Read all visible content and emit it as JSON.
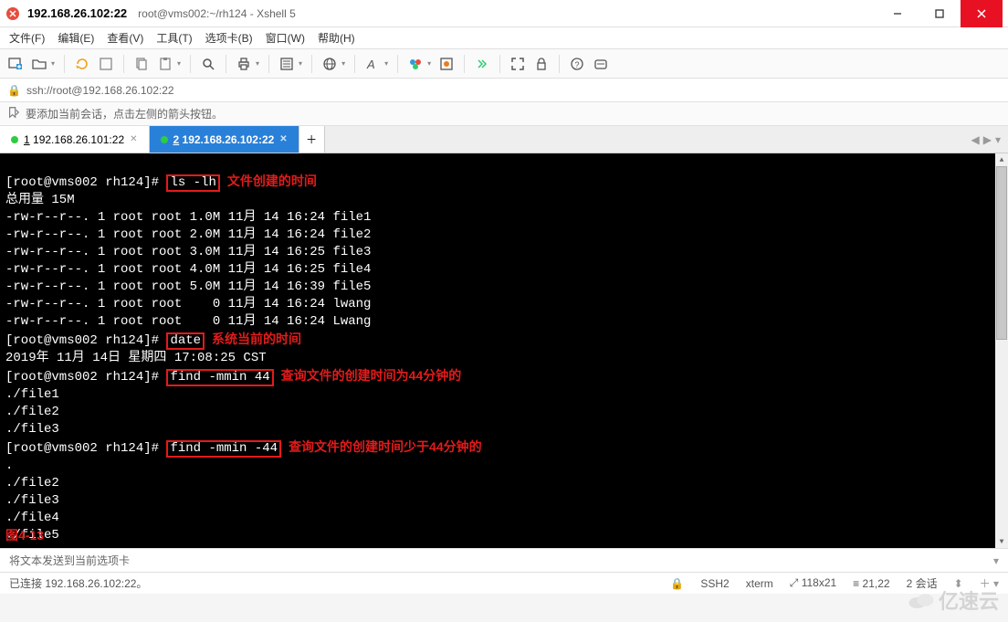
{
  "window": {
    "host": "192.168.26.102:22",
    "subtitle": "root@vms002:~/rh124 - Xshell 5"
  },
  "menu": {
    "file": "文件(F)",
    "edit": "编辑(E)",
    "view": "查看(V)",
    "tools": "工具(T)",
    "tabs": "选项卡(B)",
    "window": "窗口(W)",
    "help": "帮助(H)"
  },
  "addressbar": {
    "url": "ssh://root@192.168.26.102:22"
  },
  "infobar": {
    "tip": "要添加当前会话，点击左侧的箭头按钮。"
  },
  "tabs": {
    "tab1_prefix": "1",
    "tab1_rest": " 192.168.26.101:22",
    "tab2_prefix": "2",
    "tab2_rest": " 192.168.26.102:22"
  },
  "terminal": {
    "prompt": "[root@vms002 rh124]# ",
    "cmd1": "ls -lh",
    "anno1": "文件创建的时间",
    "total": "总用量 15M",
    "ls": [
      "-rw-r--r--. 1 root root 1.0M 11月 14 16:24 file1",
      "-rw-r--r--. 1 root root 2.0M 11月 14 16:24 file2",
      "-rw-r--r--. 1 root root 3.0M 11月 14 16:25 file3",
      "-rw-r--r--. 1 root root 4.0M 11月 14 16:25 file4",
      "-rw-r--r--. 1 root root 5.0M 11月 14 16:39 file5",
      "-rw-r--r--. 1 root root    0 11月 14 16:24 lwang",
      "-rw-r--r--. 1 root root    0 11月 14 16:24 Lwang"
    ],
    "cmd2": "date",
    "anno2": "系统当前的时间",
    "dateout": "2019年 11月 14日 星期四 17:08:25 CST",
    "cmd3": "find -mmin 44",
    "anno3": "查询文件的创建时间为44分钟的",
    "find1": [
      "./file1",
      "./file2",
      "./file3"
    ],
    "cmd4": "find -mmin -44",
    "anno4": "查询文件的创建时间少于44分钟的",
    "find2": [
      ".",
      "./file2",
      "./file3",
      "./file4",
      "./file5"
    ],
    "figlabel": "图4-13"
  },
  "bottom": {
    "hint": "将文本发送到当前选项卡"
  },
  "status": {
    "connected": "已连接 192.168.26.102:22。",
    "proto": "SSH2",
    "term": "xterm",
    "size": "118x21",
    "pos": "21,22",
    "sess": "2 会话"
  },
  "watermark": "亿速云",
  "icons": {
    "sizeprefix": "⤢",
    "posprefix": "≡",
    "lock": "🔒"
  }
}
